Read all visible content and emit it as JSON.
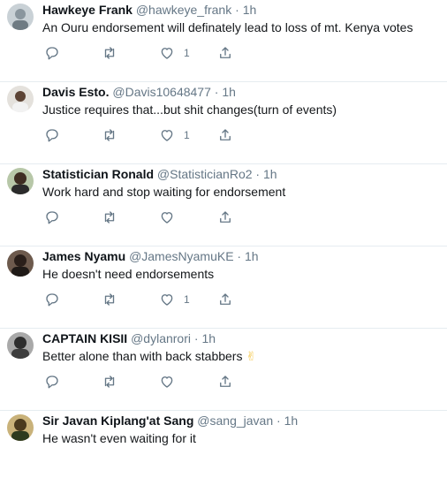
{
  "tweets": [
    {
      "name": "Hawkeye Frank",
      "handle": "@hawkeye_frank",
      "dot": "·",
      "time": "1h",
      "text": "An Ouru endorsement will definately lead to loss of mt. Kenya votes",
      "like_count": "1",
      "avatar_color": "#9aa5ad"
    },
    {
      "name": "Davis Esto.",
      "handle": "@Davis10648477",
      "dot": "·",
      "time": "1h",
      "text": "Justice requires that...but shit changes(turn of events)",
      "like_count": "1",
      "avatar_color": "#c8c2bd"
    },
    {
      "name": "Statistician Ronald",
      "handle": "@StatisticianRo2",
      "dot": "·",
      "time": "1h",
      "text": "Work hard and stop waiting for endorsement",
      "like_count": "",
      "avatar_color": "#5a4a3a"
    },
    {
      "name": "James Nyamu",
      "handle": "@JamesNyamuKE",
      "dot": "·",
      "time": "1h",
      "text": "He doesn't need endorsements",
      "like_count": "1",
      "avatar_color": "#3a2e2a"
    },
    {
      "name": "CAPTAIN KISII",
      "handle": "@dylanrori",
      "dot": "·",
      "time": "1h",
      "text": "Better alone than with back stabbers",
      "emoji": "✌",
      "like_count": "",
      "avatar_color": "#4a4a4a"
    },
    {
      "name": "Sir Javan Kiplang'at Sang",
      "handle": "@sang_javan",
      "dot": "·",
      "time": "1h",
      "text": "He wasn't even waiting for it",
      "like_count": "",
      "avatar_color": "#6b5a2e"
    }
  ],
  "icons": {
    "reply": "reply-icon",
    "retweet": "retweet-icon",
    "like": "like-icon",
    "share": "share-icon"
  },
  "colors": {
    "text": "#14171a",
    "secondary": "#657786",
    "divider": "#e6ecf0"
  }
}
